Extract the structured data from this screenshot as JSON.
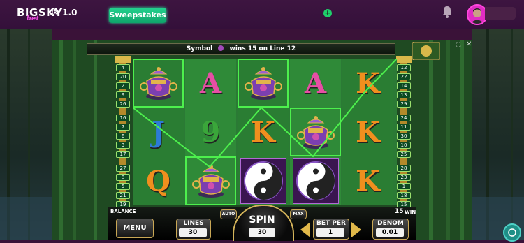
{
  "header": {
    "logo_text": "BIGSKY",
    "logo_sub": "bet",
    "version": "® 1.0",
    "sweepstakes_label": "Sweepstakes"
  },
  "win_message": {
    "prefix": "Symbol",
    "suffix": "wins 15 on Line 12"
  },
  "left_line_numbers": [
    "4",
    "20",
    "2",
    "9",
    "26",
    "16",
    "7",
    "6",
    "3",
    "17",
    "27",
    "8",
    "5",
    "21",
    "19"
  ],
  "right_line_numbers": [
    "12",
    "22",
    "14",
    "13",
    "29",
    "24",
    "11",
    "30",
    "10",
    "25",
    "28",
    "23",
    "1",
    "18",
    "15"
  ],
  "reels": [
    [
      {
        "type": "teapot",
        "highlight": true
      },
      {
        "type": "J",
        "color": "#2c7bd6",
        "highlight": false
      },
      {
        "type": "Q",
        "color": "#f08f1e",
        "highlight": false
      }
    ],
    [
      {
        "type": "A",
        "color": "#e64fa4",
        "highlight": false
      },
      {
        "type": "9",
        "color": "#3aa63a",
        "highlight": false
      },
      {
        "type": "teapot",
        "highlight": true
      }
    ],
    [
      {
        "type": "teapot",
        "highlight": true
      },
      {
        "type": "K",
        "color": "#f08f1e",
        "highlight": false
      },
      {
        "type": "yinyang",
        "highlight": false
      }
    ],
    [
      {
        "type": "A",
        "color": "#e64fa4",
        "highlight": false
      },
      {
        "type": "teapot",
        "highlight": true
      },
      {
        "type": "yinyang",
        "highlight": false
      }
    ],
    [
      {
        "type": "K",
        "color": "#f08f1e",
        "highlight": false
      },
      {
        "type": "K",
        "color": "#f08f1e",
        "highlight": false
      },
      {
        "type": "K",
        "color": "#f08f1e",
        "highlight": false
      }
    ]
  ],
  "controls": {
    "balance_label": "BALANCE",
    "auto_label": "AUTO",
    "max_label": "MAX",
    "win_value": "15",
    "win_label": "WIN",
    "menu_label": "MENU",
    "lines_label": "LINES",
    "lines_value": "30",
    "spin_label": "SPIN",
    "spin_value": "30",
    "betper_label": "BET PER",
    "betper_value": "1",
    "denom_label": "DENOM",
    "denom_value": "0.01"
  },
  "colors": {
    "accent_green": "#4df04d",
    "sweep_green": "#1fcf6b",
    "brand_pink": "#e44bd9"
  }
}
